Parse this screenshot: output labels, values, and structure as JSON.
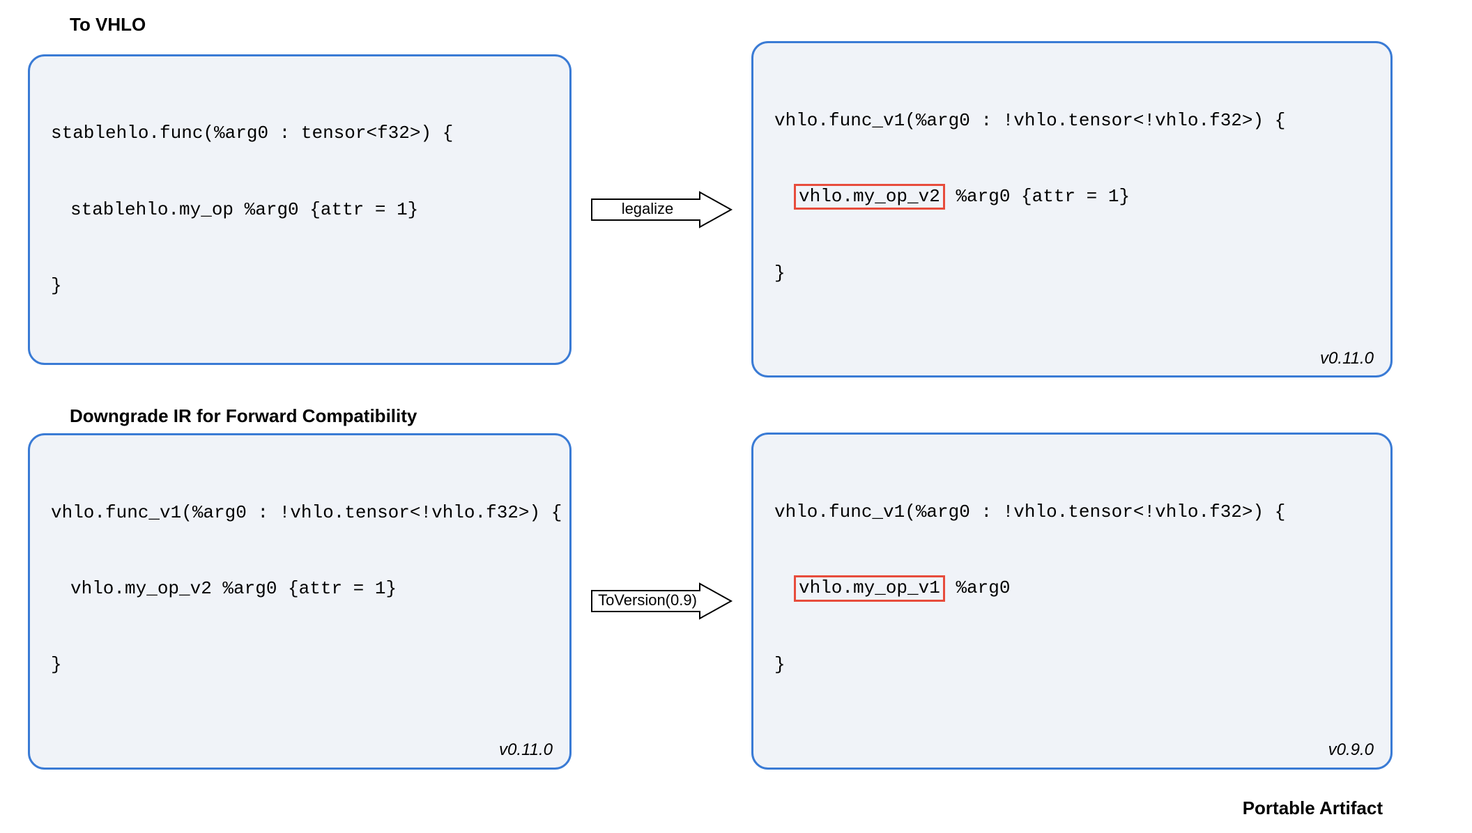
{
  "section1": {
    "title": "To VHLO",
    "leftCode": {
      "line1": "stablehlo.func(%arg0 : tensor<f32>) {",
      "line2": "stablehlo.my_op %arg0 {attr = 1}",
      "line3": "}"
    },
    "arrowLabel": "legalize",
    "rightCode": {
      "line1": "vhlo.func_v1(%arg0 : !vhlo.tensor<!vhlo.f32>) {",
      "highlight": "vhlo.my_op_v2",
      "afterHighlight": " %arg0 {attr = 1}",
      "line3": "}",
      "version": "v0.11.0"
    }
  },
  "section2": {
    "title": "Downgrade IR for Forward Compatibility",
    "leftCode": {
      "line1": "vhlo.func_v1(%arg0 : !vhlo.tensor<!vhlo.f32>) {",
      "line2": "vhlo.my_op_v2 %arg0 {attr = 1}",
      "line3": "}",
      "version": "v0.11.0"
    },
    "arrowLabel": "ToVersion(0.9)",
    "rightCode": {
      "line1": "vhlo.func_v1(%arg0 : !vhlo.tensor<!vhlo.f32>) {",
      "highlight": "vhlo.my_op_v1",
      "afterHighlight": " %arg0",
      "line3": "}",
      "version": "v0.9.0"
    }
  },
  "footerLabel": "Portable Artifact"
}
